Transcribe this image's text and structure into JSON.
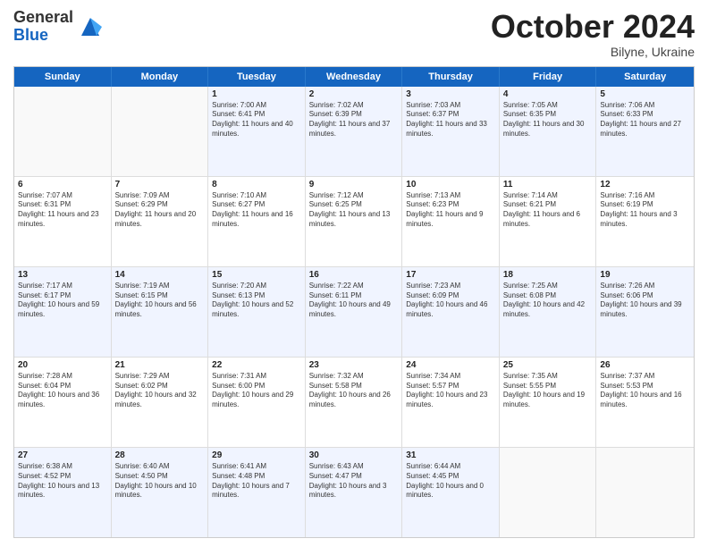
{
  "header": {
    "logo_line1": "General",
    "logo_line2": "Blue",
    "month": "October 2024",
    "location": "Bilyne, Ukraine"
  },
  "weekdays": [
    "Sunday",
    "Monday",
    "Tuesday",
    "Wednesday",
    "Thursday",
    "Friday",
    "Saturday"
  ],
  "rows": [
    [
      {
        "day": "",
        "sunrise": "",
        "sunset": "",
        "daylight": "",
        "empty": true
      },
      {
        "day": "",
        "sunrise": "",
        "sunset": "",
        "daylight": "",
        "empty": true
      },
      {
        "day": "1",
        "sunrise": "Sunrise: 7:00 AM",
        "sunset": "Sunset: 6:41 PM",
        "daylight": "Daylight: 11 hours and 40 minutes.",
        "empty": false
      },
      {
        "day": "2",
        "sunrise": "Sunrise: 7:02 AM",
        "sunset": "Sunset: 6:39 PM",
        "daylight": "Daylight: 11 hours and 37 minutes.",
        "empty": false
      },
      {
        "day": "3",
        "sunrise": "Sunrise: 7:03 AM",
        "sunset": "Sunset: 6:37 PM",
        "daylight": "Daylight: 11 hours and 33 minutes.",
        "empty": false
      },
      {
        "day": "4",
        "sunrise": "Sunrise: 7:05 AM",
        "sunset": "Sunset: 6:35 PM",
        "daylight": "Daylight: 11 hours and 30 minutes.",
        "empty": false
      },
      {
        "day": "5",
        "sunrise": "Sunrise: 7:06 AM",
        "sunset": "Sunset: 6:33 PM",
        "daylight": "Daylight: 11 hours and 27 minutes.",
        "empty": false
      }
    ],
    [
      {
        "day": "6",
        "sunrise": "Sunrise: 7:07 AM",
        "sunset": "Sunset: 6:31 PM",
        "daylight": "Daylight: 11 hours and 23 minutes.",
        "empty": false
      },
      {
        "day": "7",
        "sunrise": "Sunrise: 7:09 AM",
        "sunset": "Sunset: 6:29 PM",
        "daylight": "Daylight: 11 hours and 20 minutes.",
        "empty": false
      },
      {
        "day": "8",
        "sunrise": "Sunrise: 7:10 AM",
        "sunset": "Sunset: 6:27 PM",
        "daylight": "Daylight: 11 hours and 16 minutes.",
        "empty": false
      },
      {
        "day": "9",
        "sunrise": "Sunrise: 7:12 AM",
        "sunset": "Sunset: 6:25 PM",
        "daylight": "Daylight: 11 hours and 13 minutes.",
        "empty": false
      },
      {
        "day": "10",
        "sunrise": "Sunrise: 7:13 AM",
        "sunset": "Sunset: 6:23 PM",
        "daylight": "Daylight: 11 hours and 9 minutes.",
        "empty": false
      },
      {
        "day": "11",
        "sunrise": "Sunrise: 7:14 AM",
        "sunset": "Sunset: 6:21 PM",
        "daylight": "Daylight: 11 hours and 6 minutes.",
        "empty": false
      },
      {
        "day": "12",
        "sunrise": "Sunrise: 7:16 AM",
        "sunset": "Sunset: 6:19 PM",
        "daylight": "Daylight: 11 hours and 3 minutes.",
        "empty": false
      }
    ],
    [
      {
        "day": "13",
        "sunrise": "Sunrise: 7:17 AM",
        "sunset": "Sunset: 6:17 PM",
        "daylight": "Daylight: 10 hours and 59 minutes.",
        "empty": false
      },
      {
        "day": "14",
        "sunrise": "Sunrise: 7:19 AM",
        "sunset": "Sunset: 6:15 PM",
        "daylight": "Daylight: 10 hours and 56 minutes.",
        "empty": false
      },
      {
        "day": "15",
        "sunrise": "Sunrise: 7:20 AM",
        "sunset": "Sunset: 6:13 PM",
        "daylight": "Daylight: 10 hours and 52 minutes.",
        "empty": false
      },
      {
        "day": "16",
        "sunrise": "Sunrise: 7:22 AM",
        "sunset": "Sunset: 6:11 PM",
        "daylight": "Daylight: 10 hours and 49 minutes.",
        "empty": false
      },
      {
        "day": "17",
        "sunrise": "Sunrise: 7:23 AM",
        "sunset": "Sunset: 6:09 PM",
        "daylight": "Daylight: 10 hours and 46 minutes.",
        "empty": false
      },
      {
        "day": "18",
        "sunrise": "Sunrise: 7:25 AM",
        "sunset": "Sunset: 6:08 PM",
        "daylight": "Daylight: 10 hours and 42 minutes.",
        "empty": false
      },
      {
        "day": "19",
        "sunrise": "Sunrise: 7:26 AM",
        "sunset": "Sunset: 6:06 PM",
        "daylight": "Daylight: 10 hours and 39 minutes.",
        "empty": false
      }
    ],
    [
      {
        "day": "20",
        "sunrise": "Sunrise: 7:28 AM",
        "sunset": "Sunset: 6:04 PM",
        "daylight": "Daylight: 10 hours and 36 minutes.",
        "empty": false
      },
      {
        "day": "21",
        "sunrise": "Sunrise: 7:29 AM",
        "sunset": "Sunset: 6:02 PM",
        "daylight": "Daylight: 10 hours and 32 minutes.",
        "empty": false
      },
      {
        "day": "22",
        "sunrise": "Sunrise: 7:31 AM",
        "sunset": "Sunset: 6:00 PM",
        "daylight": "Daylight: 10 hours and 29 minutes.",
        "empty": false
      },
      {
        "day": "23",
        "sunrise": "Sunrise: 7:32 AM",
        "sunset": "Sunset: 5:58 PM",
        "daylight": "Daylight: 10 hours and 26 minutes.",
        "empty": false
      },
      {
        "day": "24",
        "sunrise": "Sunrise: 7:34 AM",
        "sunset": "Sunset: 5:57 PM",
        "daylight": "Daylight: 10 hours and 23 minutes.",
        "empty": false
      },
      {
        "day": "25",
        "sunrise": "Sunrise: 7:35 AM",
        "sunset": "Sunset: 5:55 PM",
        "daylight": "Daylight: 10 hours and 19 minutes.",
        "empty": false
      },
      {
        "day": "26",
        "sunrise": "Sunrise: 7:37 AM",
        "sunset": "Sunset: 5:53 PM",
        "daylight": "Daylight: 10 hours and 16 minutes.",
        "empty": false
      }
    ],
    [
      {
        "day": "27",
        "sunrise": "Sunrise: 6:38 AM",
        "sunset": "Sunset: 4:52 PM",
        "daylight": "Daylight: 10 hours and 13 minutes.",
        "empty": false
      },
      {
        "day": "28",
        "sunrise": "Sunrise: 6:40 AM",
        "sunset": "Sunset: 4:50 PM",
        "daylight": "Daylight: 10 hours and 10 minutes.",
        "empty": false
      },
      {
        "day": "29",
        "sunrise": "Sunrise: 6:41 AM",
        "sunset": "Sunset: 4:48 PM",
        "daylight": "Daylight: 10 hours and 7 minutes.",
        "empty": false
      },
      {
        "day": "30",
        "sunrise": "Sunrise: 6:43 AM",
        "sunset": "Sunset: 4:47 PM",
        "daylight": "Daylight: 10 hours and 3 minutes.",
        "empty": false
      },
      {
        "day": "31",
        "sunrise": "Sunrise: 6:44 AM",
        "sunset": "Sunset: 4:45 PM",
        "daylight": "Daylight: 10 hours and 0 minutes.",
        "empty": false
      },
      {
        "day": "",
        "sunrise": "",
        "sunset": "",
        "daylight": "",
        "empty": true
      },
      {
        "day": "",
        "sunrise": "",
        "sunset": "",
        "daylight": "",
        "empty": true
      }
    ]
  ],
  "alt_rows": [
    0,
    2,
    4
  ]
}
